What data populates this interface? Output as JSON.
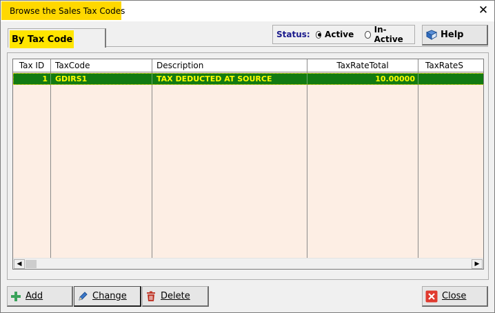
{
  "window": {
    "title": "Browse the Sales Tax Codes",
    "close_glyph": "✕"
  },
  "tab": {
    "label": "By Tax Code"
  },
  "status": {
    "label": "Status:",
    "options": [
      {
        "label": "Active",
        "checked": true
      },
      {
        "label": "In-Active",
        "checked": false
      }
    ]
  },
  "help": {
    "label": "Help",
    "icon": "help-book-icon"
  },
  "grid": {
    "columns": [
      "Tax ID",
      "TaxCode",
      "Description",
      "TaxRateTotal",
      "TaxRateS"
    ],
    "rows": [
      {
        "tax_id": "1",
        "tax_code": "GDIRS1",
        "description": "TAX DEDUCTED AT SOURCE",
        "tax_rate_total": "10.00000",
        "tax_rate_s": ""
      }
    ]
  },
  "buttons": {
    "add": "Add",
    "change": "Change",
    "delete": "Delete",
    "close": "Close"
  },
  "colors": {
    "title_highlight": "#ffd800",
    "tab_highlight": "#ffe500",
    "selected_row_bg": "#127a12",
    "selected_row_text": "#ffff00",
    "grid_bg": "#fdeee4"
  }
}
